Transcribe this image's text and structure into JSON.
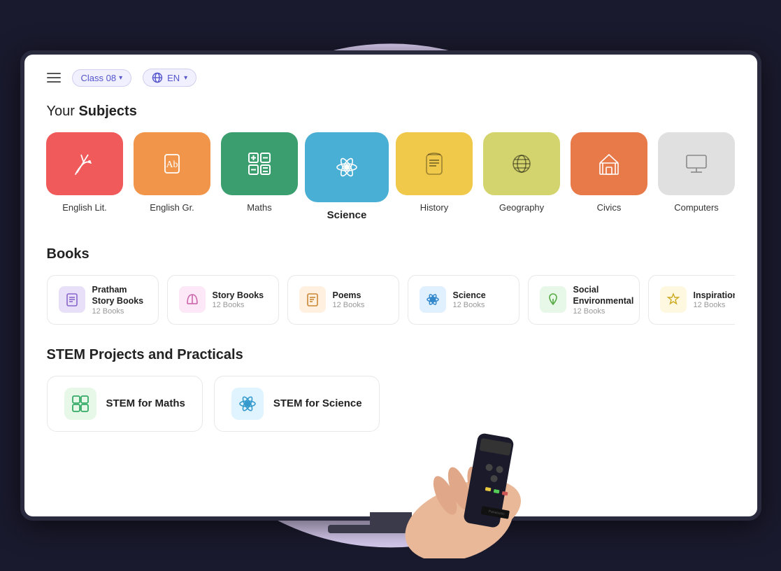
{
  "header": {
    "menu_label": "menu",
    "class_label": "Class 08",
    "lang_label": "EN",
    "lang_icon": "globe"
  },
  "subjects_section": {
    "title_plain": "Your ",
    "title_bold": "Subjects",
    "subjects": [
      {
        "id": "english-lit",
        "label": "English Lit.",
        "color": "#f05a5a",
        "icon": "feather"
      },
      {
        "id": "english-gr",
        "label": "English Gr.",
        "color": "#f0954a",
        "icon": "text"
      },
      {
        "id": "maths",
        "label": "Maths",
        "color": "#3a9e6e",
        "icon": "calc"
      },
      {
        "id": "science",
        "label": "Science",
        "color": "#4aafd4",
        "icon": "atom",
        "active": true
      },
      {
        "id": "history",
        "label": "History",
        "color": "#f0c84a",
        "icon": "scroll"
      },
      {
        "id": "geography",
        "label": "Geography",
        "color": "#d4d46e",
        "icon": "globe"
      },
      {
        "id": "civics",
        "label": "Civics",
        "color": "#e87a4a",
        "icon": "building"
      },
      {
        "id": "computers",
        "label": "Computers",
        "color": "#d0d0d0",
        "icon": "monitor"
      }
    ]
  },
  "books_section": {
    "title": "Books",
    "books": [
      {
        "id": "pratham",
        "label": "Pratham Story Books",
        "count": "12 Books",
        "color": "#e8e0f8",
        "icon_color": "#8866cc",
        "icon": "book"
      },
      {
        "id": "story",
        "label": "Story Books",
        "count": "12 Books",
        "color": "#fde8f8",
        "icon_color": "#cc66aa",
        "icon": "book-open"
      },
      {
        "id": "poems",
        "label": "Poems",
        "count": "12 Books",
        "color": "#fff0e0",
        "icon_color": "#cc8833",
        "icon": "poem"
      },
      {
        "id": "science-b",
        "label": "Science",
        "count": "12 Books",
        "color": "#e0f0ff",
        "icon_color": "#3388cc",
        "icon": "atom"
      },
      {
        "id": "social-env",
        "label": "Social Environmental",
        "count": "12 Books",
        "color": "#e8f8e8",
        "icon_color": "#55aa44",
        "icon": "leaf"
      },
      {
        "id": "inspirational",
        "label": "Inspirational",
        "count": "12 Books",
        "color": "#fff8e0",
        "icon_color": "#ccaa22",
        "icon": "star"
      }
    ]
  },
  "stem_section": {
    "title": "STEM Projects and Practicals",
    "items": [
      {
        "id": "stem-maths",
        "label": "STEM for Maths",
        "color": "#e8f8e8",
        "icon_color": "#33aa66",
        "icon": "grid"
      },
      {
        "id": "stem-science",
        "label": "STEM for Science",
        "color": "#e0f4ff",
        "icon_color": "#3399cc",
        "icon": "atom"
      }
    ]
  }
}
